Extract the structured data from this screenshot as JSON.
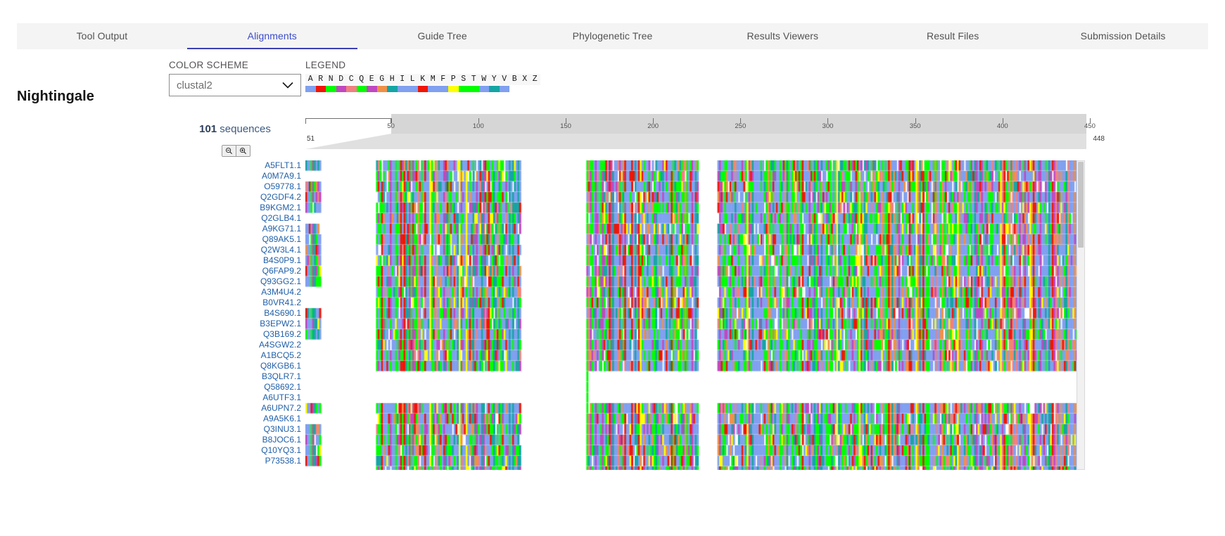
{
  "tabs": [
    {
      "label": "Tool Output",
      "active": false
    },
    {
      "label": "Alignments",
      "active": true
    },
    {
      "label": "Guide Tree",
      "active": false
    },
    {
      "label": "Phylogenetic Tree",
      "active": false
    },
    {
      "label": "Results Viewers",
      "active": false
    },
    {
      "label": "Result Files",
      "active": false
    },
    {
      "label": "Submission Details",
      "active": false
    }
  ],
  "app": {
    "title": "Nightingale"
  },
  "color_scheme": {
    "label": "COLOR SCHEME",
    "value": "clustal2",
    "chevron_icon": "chevron-down-icon"
  },
  "legend": {
    "label": "LEGEND",
    "letters": [
      "A",
      "R",
      "N",
      "D",
      "C",
      "Q",
      "E",
      "G",
      "H",
      "I",
      "L",
      "K",
      "M",
      "F",
      "P",
      "S",
      "T",
      "W",
      "Y",
      "V",
      "B",
      "X",
      "Z"
    ],
    "colors": [
      "#80a0f0",
      "#f01505",
      "#00ff00",
      "#c048c0",
      "#f08080",
      "#00ff00",
      "#c048c0",
      "#f09048",
      "#15a4a4",
      "#80a0f0",
      "#80a0f0",
      "#f01505",
      "#80a0f0",
      "#80a0f0",
      "#ffff00",
      "#00ff00",
      "#00ff00",
      "#80a0f0",
      "#15a4a4",
      "#80a0f0",
      "#ffffff",
      "#ffffff",
      "#ffffff"
    ]
  },
  "sequence_panel": {
    "count_number": "101",
    "count_label": " sequences",
    "zoom_out_icon": "zoom-out-icon",
    "zoom_in_icon": "zoom-in-icon",
    "ids": [
      "A5FLT1.1",
      "A0M7A9.1",
      "O59778.1",
      "Q2GDF4.2",
      "B9KGM2.1",
      "Q2GLB4.1",
      "A9KG71.1",
      "Q89AK5.1",
      "Q2W3L4.1",
      "B4S0P9.1",
      "Q6FAP9.2",
      "Q93GG2.1",
      "A3M4U4.2",
      "B0VR41.2",
      "B4S690.1",
      "B3EPW2.1",
      "Q3B169.2",
      "A4SGW2.2",
      "A1BCQ5.2",
      "Q8KGB6.1",
      "B3QLR7.1",
      "Q58692.1",
      "A6UTF3.1",
      "A6UPN7.2",
      "A9A5K6.1",
      "Q3INU3.1",
      "B8JOC6.1",
      "Q10YQ3.1",
      "P73538.1"
    ]
  },
  "navigation": {
    "tick_labels": [
      "50",
      "100",
      "150",
      "200",
      "250",
      "300",
      "350",
      "400",
      "450"
    ],
    "tick_values": [
      50,
      100,
      150,
      200,
      250,
      300,
      350,
      400,
      450
    ],
    "range_start": "51",
    "range_end": "448",
    "display_start": 51,
    "display_end": 448,
    "axis_min": 1,
    "axis_max": 448
  },
  "scrollbar": {
    "vertical_thumb_name": "vertical-scroll-thumb"
  }
}
